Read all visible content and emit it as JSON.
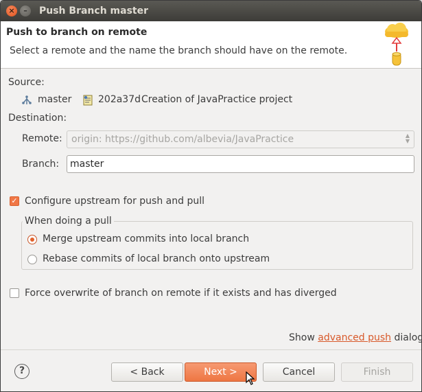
{
  "window": {
    "title": "Push Branch master"
  },
  "banner": {
    "heading": "Push to branch on remote",
    "description": "Select a remote and the name the branch should have on the remote."
  },
  "source": {
    "label": "Source:",
    "branch": "master",
    "commit_id": "202a37d",
    "commit_message": "Creation of JavaPractice project"
  },
  "destination": {
    "label": "Destination:",
    "remote_label": "Remote:",
    "remote_value": "origin: https://github.com/albevia/JavaPractice",
    "branch_label": "Branch:",
    "branch_value": "master"
  },
  "upstream": {
    "label": "Configure upstream for push and pull",
    "checked": true,
    "group_title": "When doing a pull",
    "options": [
      {
        "label": "Merge upstream commits into local branch",
        "selected": true
      },
      {
        "label": "Rebase commits of local branch onto upstream",
        "selected": false
      }
    ]
  },
  "force": {
    "label": "Force overwrite of branch on remote if it exists and has diverged",
    "checked": false
  },
  "advanced": {
    "prefix": "Show",
    "link": "advanced push",
    "suffix": "dialog"
  },
  "buttons": {
    "help": "?",
    "back": "< Back",
    "next": "Next >",
    "cancel": "Cancel",
    "finish": "Finish"
  },
  "colors": {
    "accent": "#ee7643",
    "link": "#d8592a",
    "titlebar": "#3d3c38"
  },
  "icons": [
    "close-icon",
    "minimize-icon",
    "cloud-push-icon",
    "branch-icon",
    "commit-icon",
    "help-icon",
    "mouse-cursor-icon"
  ]
}
